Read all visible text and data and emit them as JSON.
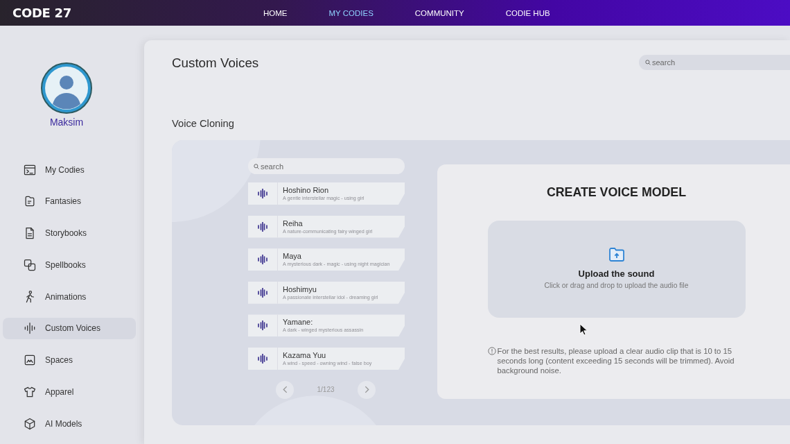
{
  "header": {
    "logo": "CODE 27",
    "nav": [
      {
        "label": "HOME",
        "selected": false
      },
      {
        "label": "MY CODIES",
        "selected": true
      },
      {
        "label": "COMMUNITY",
        "selected": false
      },
      {
        "label": "CODIE HUB",
        "selected": false
      }
    ]
  },
  "sidebar": {
    "user_name": "Maksim",
    "items": [
      {
        "label": "My Codies",
        "selected": false
      },
      {
        "label": "Fantasies",
        "selected": false
      },
      {
        "label": "Storybooks",
        "selected": false
      },
      {
        "label": "Spellbooks",
        "selected": false
      },
      {
        "label": "Animations",
        "selected": false
      },
      {
        "label": "Custom Voices",
        "selected": true
      },
      {
        "label": "Spaces",
        "selected": false
      },
      {
        "label": "Apparel",
        "selected": false
      },
      {
        "label": "AI Models",
        "selected": false
      }
    ]
  },
  "page": {
    "title": "Custom Voices",
    "search": {
      "placeholder": "search"
    },
    "section_title": "Voice Cloning"
  },
  "voice_list": {
    "search": {
      "placeholder": "search"
    },
    "voices": [
      {
        "name": "Hoshino Rion",
        "description": "A gentle interstellar magic - using girl"
      },
      {
        "name": "Reiha",
        "description": "A nature-communicating fairy winged girl"
      },
      {
        "name": "Maya",
        "description": "A mysterious dark - magic - using night magician"
      },
      {
        "name": "Hoshimyu",
        "description": "A passionate interstellar idol - dreaming girl"
      },
      {
        "name": "Yamane:",
        "description": "A dark - winged mysterious assassin"
      },
      {
        "name": "Kazama Yuu",
        "description": "A wind - speed - owning wind - false boy"
      }
    ],
    "pagination": "1/123"
  },
  "create_panel": {
    "title": "CREATE VOICE MODEL",
    "upload": {
      "title": "Upload the sound",
      "hint": "Click or drag and drop to upload the audio file"
    },
    "note": "For the best results, please upload a clear audio clip that is 10 to 15 seconds long (content exceeding 15 seconds will be trimmed). Avoid background noise."
  }
}
